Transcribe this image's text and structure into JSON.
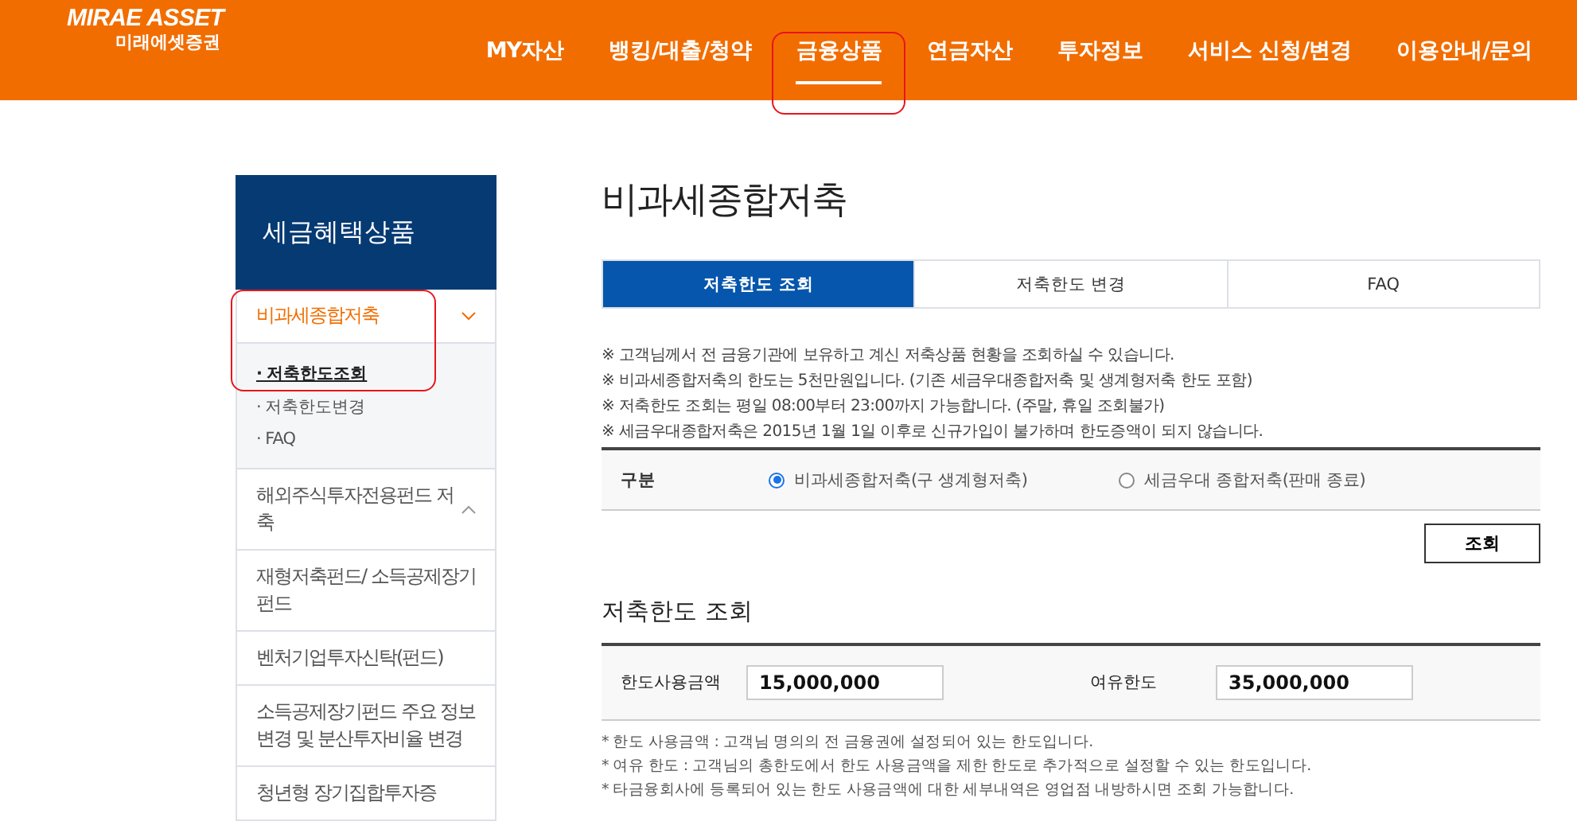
{
  "header": {
    "logo": {
      "line_1": "MIRAE ASSET",
      "line_2": "미래에셋증권"
    },
    "nav": [
      {
        "label": "MY자산",
        "selected": false
      },
      {
        "label": "뱅킹/대출/청약",
        "selected": false
      },
      {
        "label": "금융상품",
        "selected": true
      },
      {
        "label": "연금자산",
        "selected": false
      },
      {
        "label": "투자정보",
        "selected": false
      },
      {
        "label": "서비스 신청/변경",
        "selected": false
      },
      {
        "label": "이용안내/문의",
        "selected": false
      }
    ]
  },
  "sidebar": {
    "title": "세금혜택상품",
    "items": [
      {
        "label": "비과세종합저축",
        "expanded": true,
        "selected": true,
        "children": [
          {
            "label": "· 저축한도조회",
            "selected": true
          },
          {
            "label": "· 저축한도변경",
            "selected": false
          },
          {
            "label": "· FAQ",
            "selected": false
          }
        ]
      },
      {
        "label": "해외주식투자전용펀드 저축",
        "expanded": false,
        "selected": false
      },
      {
        "label": "재형저축펀드/ 소득공제장기펀드",
        "selected": false
      },
      {
        "label": "벤처기업투자신탁(펀드)",
        "selected": false
      },
      {
        "label": "소득공제장기펀드 주요 정보변경 및 분산투자비율 변경",
        "selected": false
      },
      {
        "label": "청년형 장기집합투자증",
        "selected": false
      }
    ]
  },
  "main": {
    "title": "비과세종합저축",
    "tabs": [
      {
        "label": "저축한도 조회",
        "selected": true
      },
      {
        "label": "저축한도 변경",
        "selected": false
      },
      {
        "label": "FAQ",
        "selected": false
      }
    ],
    "notices": [
      "※ 고객님께서 전 금융기관에 보유하고 계신 저축상품 현황을 조회하실 수 있습니다.",
      "※ 비과세종합저축의 한도는 5천만원입니다. (기존 세금우대종합저축 및 생계형저축 한도 포함)",
      "※ 저축한도 조회는 평일 08:00부터 23:00까지 가능합니다. (주말, 휴일 조회불가)",
      "※ 세금우대종합저축은 2015년 1월 1일 이후로 신규가입이 불가하며 한도증액이 되지 않습니다."
    ],
    "type_row": {
      "label": "구분",
      "options": [
        {
          "label": "비과세종합저축(구 생계형저축)",
          "selected": true
        },
        {
          "label": "세금우대 종합저축(판매 종료)",
          "selected": false
        }
      ]
    },
    "search_button": "조회",
    "result": {
      "title": "저축한도 조회",
      "fields": [
        {
          "label": "한도사용금액",
          "value": "15,000,000"
        },
        {
          "label": "여유한도",
          "value": "35,000,000"
        }
      ],
      "notes": [
        "* 한도 사용금액 : 고객님 명의의 전 금융권에 설정되어 있는 한도입니다.",
        "* 여유 한도 : 고객님의 총한도에서 한도 사용금액을 제한 한도로 추가적으로 설정할 수 있는 한도입니다.",
        "* 타금융회사에 등록되어 있는 한도 사용금액에 대한 세부내역은 영업점 내방하시면 조회 가능합니다."
      ]
    }
  }
}
